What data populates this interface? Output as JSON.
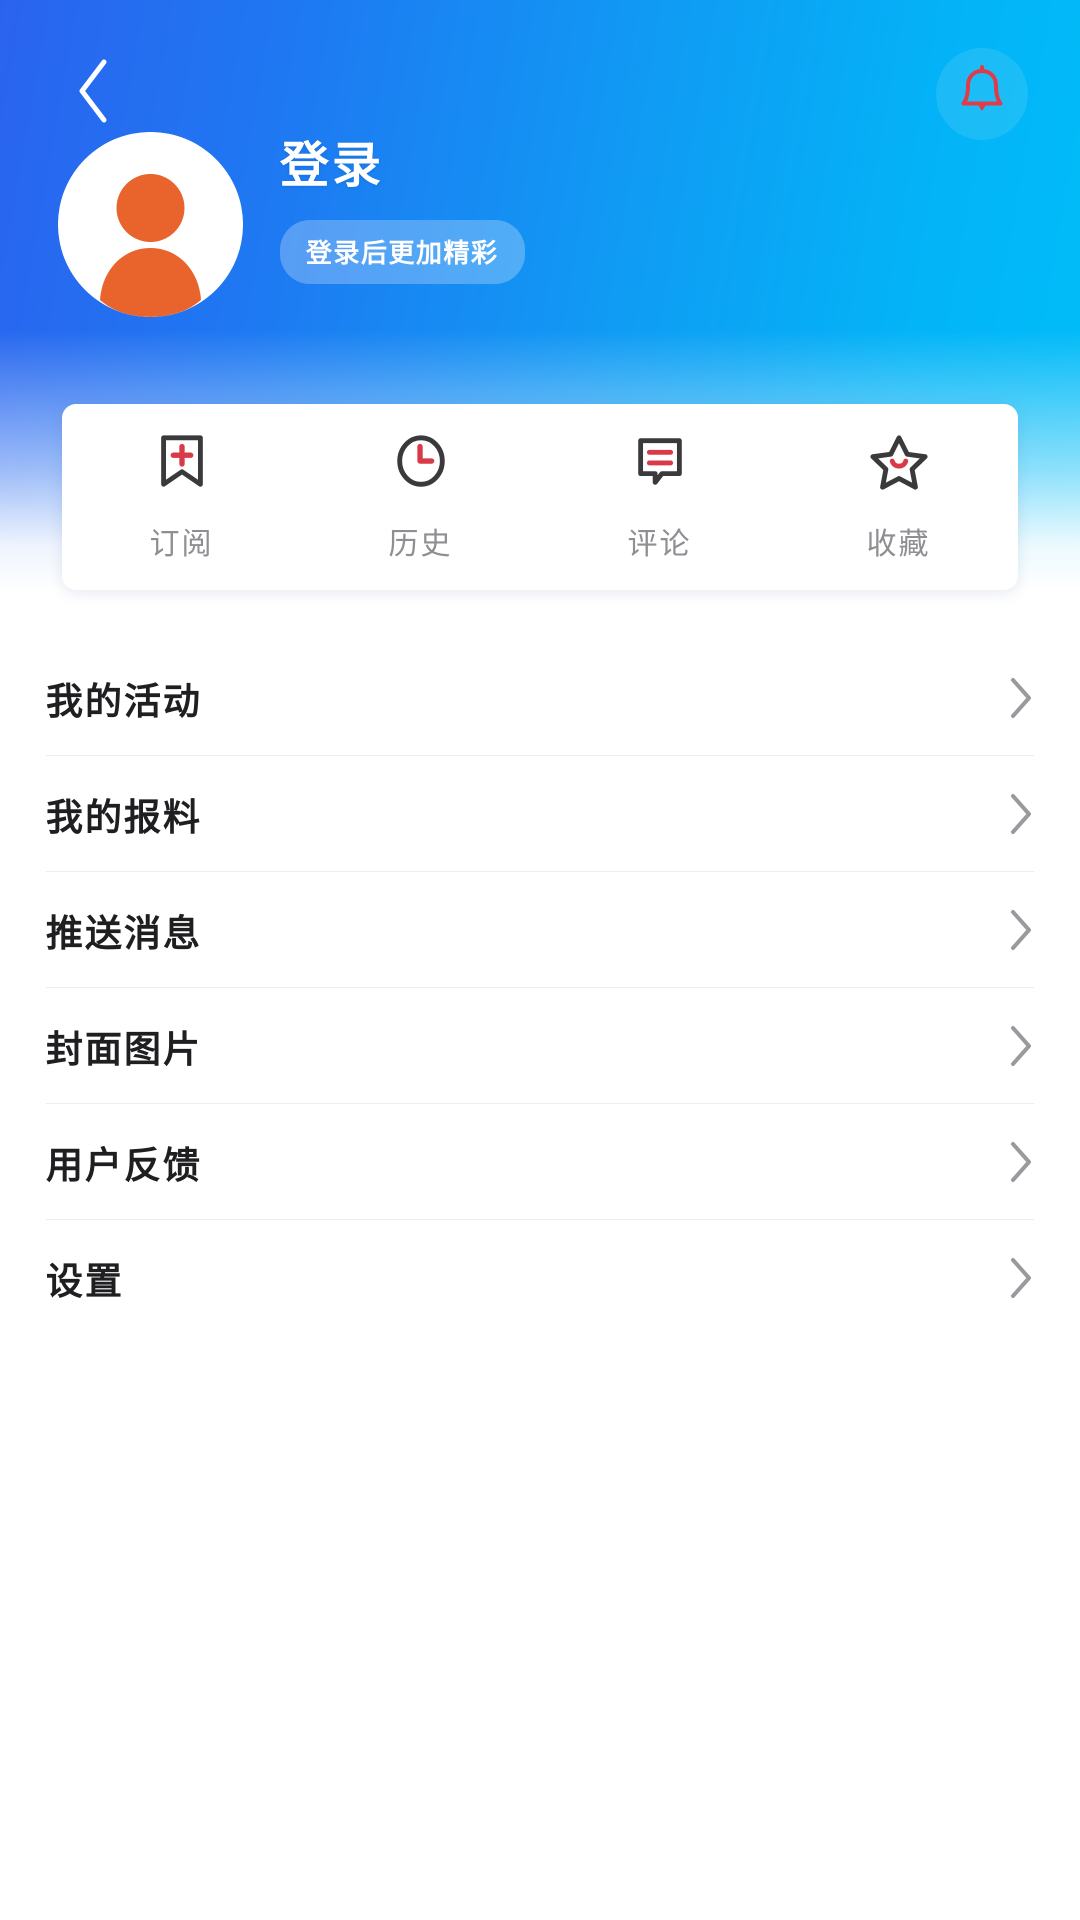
{
  "header": {
    "back_icon": "chevron-left-icon",
    "bell_icon": "bell-icon",
    "login_title": "登录",
    "login_badge": "登录后更加精彩",
    "avatar_icon": "user-avatar-placeholder",
    "gradient_from": "#2a63ef",
    "gradient_to": "#00bdf8",
    "avatar_bg": "#ffffff",
    "avatar_figure_color": "#e8642c",
    "bell_color": "#e03b4a"
  },
  "quick_actions": [
    {
      "label": "订阅",
      "icon": "bookmark-plus-icon"
    },
    {
      "label": "历史",
      "icon": "clock-icon"
    },
    {
      "label": "评论",
      "icon": "comment-bubble-icon"
    },
    {
      "label": "收藏",
      "icon": "star-smile-icon"
    }
  ],
  "quick_action_accent": "#d93a48",
  "quick_action_outline": "#3a3a3c",
  "menu": {
    "chevron_icon": "chevron-right-icon",
    "items": [
      {
        "label": "我的活动"
      },
      {
        "label": "我的报料"
      },
      {
        "label": "推送消息"
      },
      {
        "label": "封面图片"
      },
      {
        "label": "用户反馈"
      },
      {
        "label": "设置"
      }
    ]
  }
}
